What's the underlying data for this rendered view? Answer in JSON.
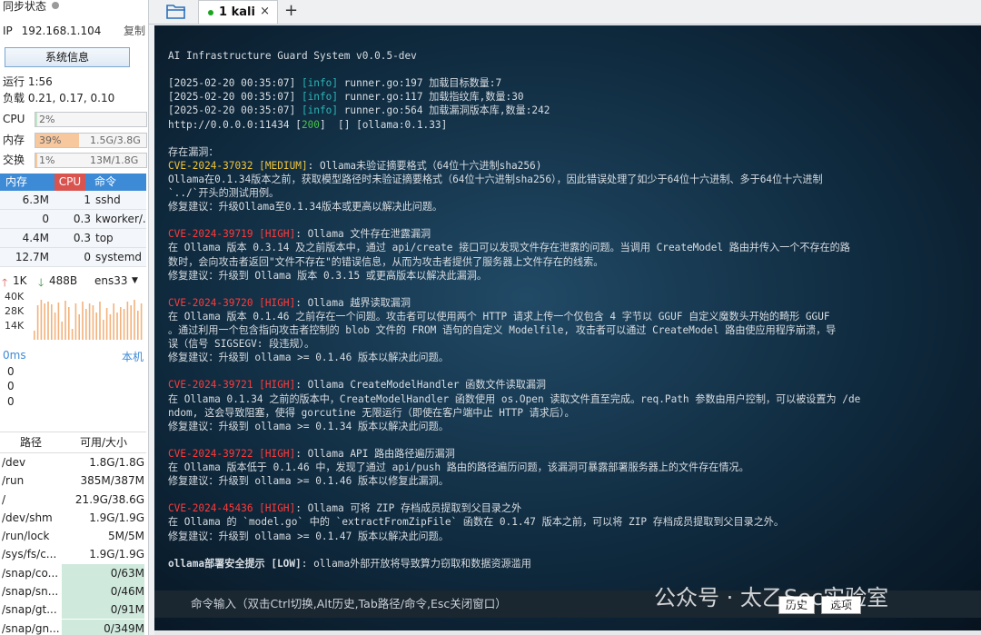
{
  "left_panel": {
    "sync_status": "同步状态",
    "ip_label": "IP",
    "ip": "192.168.1.104",
    "copy": "复制",
    "sysinfo_button": "系统信息",
    "uptime": "运行 1:56",
    "load": "负载 0.21, 0.17, 0.10",
    "cpu": {
      "label": "CPU",
      "percent": "2%",
      "fraction": 0.02
    },
    "mem": {
      "label": "内存",
      "percent": "39%",
      "value": "1.5G/3.8G",
      "fraction": 0.39
    },
    "swap": {
      "label": "交换",
      "percent": "1%",
      "value": "13M/1.8G",
      "fraction": 0.01
    },
    "process_table": {
      "headers": [
        "内存",
        "CPU",
        "命令"
      ],
      "rows": [
        [
          "6.3M",
          "1",
          "sshd"
        ],
        [
          "0",
          "0.3",
          "kworker/..."
        ],
        [
          "4.4M",
          "0.3",
          "top"
        ],
        [
          "12.7M",
          "0",
          "systemd"
        ]
      ]
    },
    "net": {
      "up": "1K",
      "down": "488B",
      "iface": "ens33"
    },
    "net_chart": {
      "y_labels": [
        "40K",
        "28K",
        "14K"
      ]
    },
    "ping": {
      "latency": "0ms",
      "target": "本机",
      "values": [
        "0",
        "0",
        "0"
      ]
    },
    "fs_table": {
      "headers": [
        "路径",
        "可用/大小"
      ],
      "rows": [
        [
          "/dev",
          "1.8G/1.8G"
        ],
        [
          "/run",
          "385M/387M"
        ],
        [
          "/",
          "21.9G/38.6G"
        ],
        [
          "/dev/shm",
          "1.9G/1.9G"
        ],
        [
          "/run/lock",
          "5M/5M"
        ],
        [
          "/sys/fs/c...",
          "1.9G/1.9G"
        ],
        [
          "/snap/co...",
          "0/63M"
        ],
        [
          "/snap/sn...",
          "0/46M"
        ],
        [
          "/snap/gt...",
          "0/91M"
        ],
        [
          "/snap/gn...",
          "0/349M"
        ]
      ]
    }
  },
  "tabs": {
    "active": "1 kali",
    "close": "×",
    "add": "+"
  },
  "terminal": {
    "lines": [
      {
        "segs": [
          [
            "AI Infrastructure Guard System v0.0.5-dev",
            ""
          ]
        ]
      },
      {
        "segs": [
          [
            "",
            ""
          ]
        ]
      },
      {
        "segs": [
          [
            "[2025-02-20 00:35:07] ",
            ""
          ],
          [
            "[info]",
            "cy"
          ],
          [
            " runner.go:197 加载目标数量:7",
            ""
          ]
        ]
      },
      {
        "segs": [
          [
            "[2025-02-20 00:35:07] ",
            ""
          ],
          [
            "[info]",
            "cy"
          ],
          [
            " runner.go:117 加载指纹库,数量:30",
            ""
          ]
        ]
      },
      {
        "segs": [
          [
            "[2025-02-20 00:35:07] ",
            ""
          ],
          [
            "[info]",
            "cy"
          ],
          [
            " runner.go:564 加载漏洞版本库,数量:242",
            ""
          ]
        ]
      },
      {
        "segs": [
          [
            "http://0.0.0.0:11434 [",
            ""
          ],
          [
            "200",
            "gr"
          ],
          [
            "]  [] [ollama:0.1.33]",
            ""
          ]
        ]
      },
      {
        "segs": [
          [
            "",
            ""
          ]
        ]
      },
      {
        "segs": [
          [
            "存在漏洞：",
            ""
          ]
        ]
      },
      {
        "segs": [
          [
            "CVE-2024-37032 [MEDIUM]",
            "yw"
          ],
          [
            ": Ollama未验证摘要格式（64位十六进制sha256)",
            ""
          ]
        ]
      },
      {
        "segs": [
          [
            "Ollama在0.1.34版本之前，获取模型路径时未验证摘要格式（64位十六进制sha256），因此错误处理了如少于64位十六进制、多于64位十六进制",
            ""
          ]
        ]
      },
      {
        "segs": [
          [
            "`../`开头的测试用例。",
            ""
          ]
        ]
      },
      {
        "segs": [
          [
            "修复建议：升级Ollama至0.1.34版本或更高以解决此问题。",
            ""
          ]
        ]
      },
      {
        "segs": [
          [
            "",
            ""
          ]
        ]
      },
      {
        "segs": [
          [
            "CVE-2024-39719 [HIGH]",
            "rd"
          ],
          [
            ": Ollama 文件存在泄露漏洞",
            ""
          ]
        ]
      },
      {
        "segs": [
          [
            "在 Ollama 版本 0.3.14 及之前版本中，通过 api/create 接口可以发现文件存在泄露的问题。当调用 CreateModel 路由并传入一个不存在的路",
            ""
          ]
        ]
      },
      {
        "segs": [
          [
            "数时，会向攻击者返回\"文件不存在\"的错误信息，从而为攻击者提供了服务器上文件存在的线索。",
            ""
          ]
        ]
      },
      {
        "segs": [
          [
            "修复建议：升级到 Ollama 版本 0.3.15 或更高版本以解决此漏洞。",
            ""
          ]
        ]
      },
      {
        "segs": [
          [
            "",
            ""
          ]
        ]
      },
      {
        "segs": [
          [
            "CVE-2024-39720 [HIGH]",
            "rd"
          ],
          [
            ": Ollama 越界读取漏洞",
            ""
          ]
        ]
      },
      {
        "segs": [
          [
            "在 Ollama 版本 0.1.46 之前存在一个问题。攻击者可以使用两个 HTTP 请求上传一个仅包含 4 字节以 GGUF 自定义魔数头开始的畸形 GGUF",
            ""
          ]
        ]
      },
      {
        "segs": [
          [
            "。通过利用一个包含指向攻击者控制的 blob 文件的 FROM 语句的自定义 Modelfile, 攻击者可以通过 CreateModel 路由使应用程序崩溃，导",
            ""
          ]
        ]
      },
      {
        "segs": [
          [
            "误（信号 SIGSEGV: 段违规）。",
            ""
          ]
        ]
      },
      {
        "segs": [
          [
            "修复建议：升级到 ollama >= 0.1.46 版本以解决此问题。",
            ""
          ]
        ]
      },
      {
        "segs": [
          [
            "",
            ""
          ]
        ]
      },
      {
        "segs": [
          [
            "CVE-2024-39721 [HIGH]",
            "rd"
          ],
          [
            ": Ollama CreateModelHandler 函数文件读取漏洞",
            ""
          ]
        ]
      },
      {
        "segs": [
          [
            "在 Ollama 0.1.34 之前的版本中，CreateModelHandler 函数使用 os.Open 读取文件直至完成。req.Path 参数由用户控制，可以被设置为 /de",
            ""
          ]
        ]
      },
      {
        "segs": [
          [
            "ndom, 这会导致阻塞，使得 gorcutine 无限运行（即使在客户端中止 HTTP 请求后）。",
            ""
          ]
        ]
      },
      {
        "segs": [
          [
            "修复建议：升级到 ollama >= 0.1.34 版本以解决此问题。",
            ""
          ]
        ]
      },
      {
        "segs": [
          [
            "",
            ""
          ]
        ]
      },
      {
        "segs": [
          [
            "CVE-2024-39722 [HIGH]",
            "rd"
          ],
          [
            ": Ollama API 路由路径遍历漏洞",
            ""
          ]
        ]
      },
      {
        "segs": [
          [
            "在 Ollama 版本低于 0.1.46 中，发现了通过 api/push 路由的路径遍历问题，该漏洞可暴露部署服务器上的文件存在情况。",
            ""
          ]
        ]
      },
      {
        "segs": [
          [
            "修复建议：升级到 ollama >= 0.1.46 版本以修复此漏洞。",
            ""
          ]
        ]
      },
      {
        "segs": [
          [
            "",
            ""
          ]
        ]
      },
      {
        "segs": [
          [
            "CVE-2024-45436 [HIGH]",
            "rd"
          ],
          [
            ": Ollama 可将 ZIP 存档成员提取到父目录之外",
            ""
          ]
        ]
      },
      {
        "segs": [
          [
            "在 Ollama 的 `model.go` 中的 `extractFromZipFile` 函数在 0.1.47 版本之前，可以将 ZIP 存档成员提取到父目录之外。",
            ""
          ]
        ]
      },
      {
        "segs": [
          [
            "修复建议：升级到 ollama >= 0.1.47 版本以解决此问题。",
            ""
          ]
        ]
      },
      {
        "segs": [
          [
            "",
            ""
          ]
        ]
      },
      {
        "segs": [
          [
            "ollama部署安全提示 [LOW]",
            "bold"
          ],
          [
            ": ollama外部开放将导致算力窃取和数据资源滥用",
            ""
          ]
        ]
      }
    ],
    "input_placeholder": "命令输入（双击Ctrl切换,Alt历史,Tab路径/命令,Esc关闭窗口）",
    "history_button": "历史",
    "options_button": "选项",
    "watermark": "公众号 · 太乙Sec实验室"
  },
  "colors": {
    "accent": "#3d8ad6",
    "mem_fill": "#f7c79e",
    "cpu_fill": "#bfe4c6",
    "info": "#2ab7b7",
    "medium": "#f0c43a",
    "high": "#ff3a3a"
  }
}
